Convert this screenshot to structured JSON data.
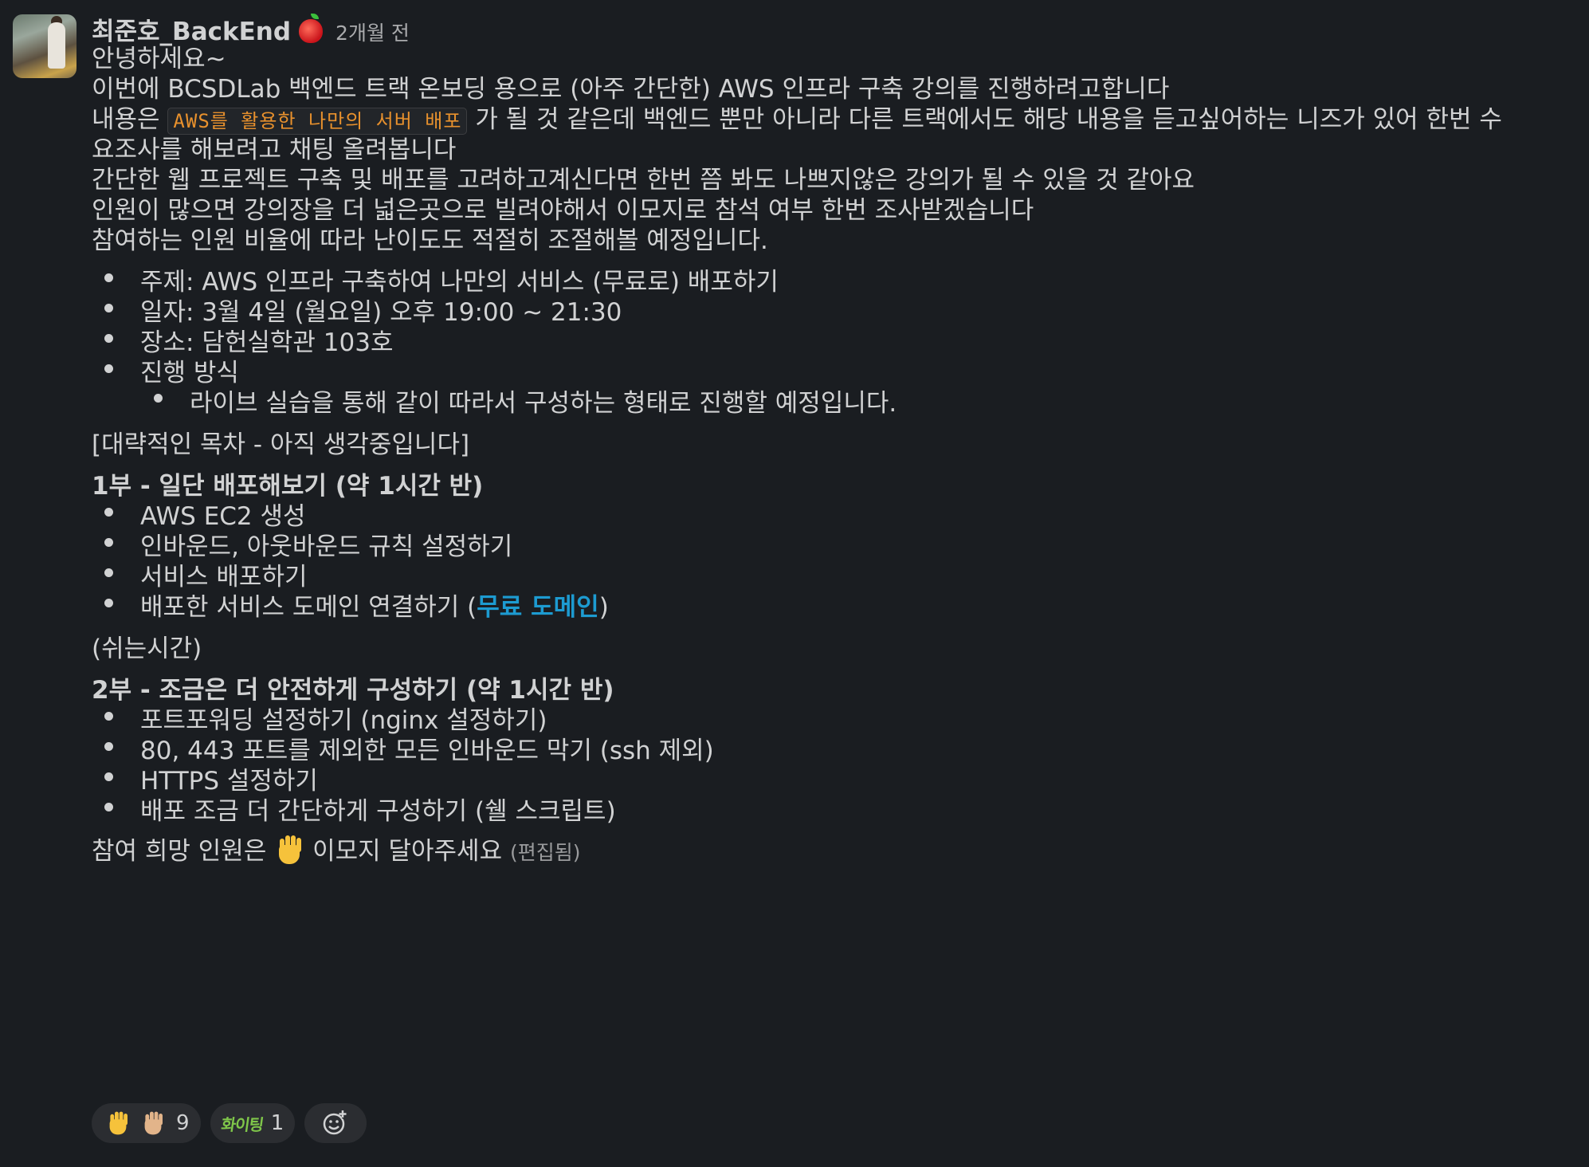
{
  "message": {
    "author": "최준호_BackEnd",
    "timestamp": "2개월 전",
    "lines": [
      "안녕하세요~",
      "이번에 BCSDLab 백엔드 트랙 온보딩 용으로 (아주 간단한) AWS 인프라 구축 강의를 진행하려고합니다",
      "요조사를 해보려고 채팅 올려봅니다",
      "간단한 웹 프로젝트 구축 및 배포를 고려하고계신다면 한번 쯤 봐도 나쁘지않은 강의가 될 수 있을 것 같아요",
      "인원이 많으면 강의장을 더 넓은곳으로 빌려야해서 이모지로 참석 여부 한번 조사받겠습니다",
      "참여하는 인원 비율에 따라 난이도도 적절히 조절해볼 예정입니다."
    ],
    "content_prefix": "내용은",
    "content_code": "AWS를 활용한 나만의 서버 배포",
    "content_suffix": "가 될 것 같은데 백엔드 뿐만 아니라 다른 트랙에서도 해당 내용을 듣고싶어하는 니즈가 있어 한번 수",
    "info_bullets": [
      "주제: AWS 인프라 구축하여 나만의 서비스 (무료로) 배포하기",
      "일자: 3월 4일 (월요일) 오후 19:00 ~ 21:30",
      "장소: 담헌실학관 103호",
      "진행 방식"
    ],
    "info_sub_bullet": "라이브 실습을 통해 같이 따라서 구성하는 형태로 진행할 예정입니다.",
    "toc_title": "[대략적인 목차 - 아직 생각중입니다]",
    "part1_title": "1부 - 일단 배포해보기 (약 1시간 반)",
    "part1_bullets": [
      "AWS EC2 생성",
      "인바운드, 아웃바운드 규칙 설정하기",
      "서비스 배포하기"
    ],
    "part1_last_prefix": "배포한 서비스 도메인 연결하기 (",
    "part1_last_link": "무료 도메인",
    "part1_last_suffix": ")",
    "break_text": "(쉬는시간)",
    "part2_title": "2부 - 조금은 더 안전하게 구성하기 (약 1시간 반)",
    "part2_bullets": [
      "포트포워딩 설정하기 (nginx 설정하기)",
      "80, 443 포트를 제외한 모든 인바운드 막기 (ssh 제외)",
      "HTTPS 설정하기",
      "배포 조금 더 간단하게 구성하기 (쉘 스크립트)"
    ],
    "closing_prefix": "참여 희망 인원은",
    "closing_suffix": "이모지 달아주세요",
    "edited_label": "(편집됨)"
  },
  "reactions": [
    {
      "emoji": "raised-hand",
      "count": "9"
    },
    {
      "emoji": "화이팅",
      "count": "1"
    }
  ],
  "add_reaction_icon": "add-reaction-icon",
  "colors": {
    "background": "#1a1d21",
    "text": "#d1d2d3",
    "link": "#1d9bd1",
    "code": "#e8912d"
  }
}
